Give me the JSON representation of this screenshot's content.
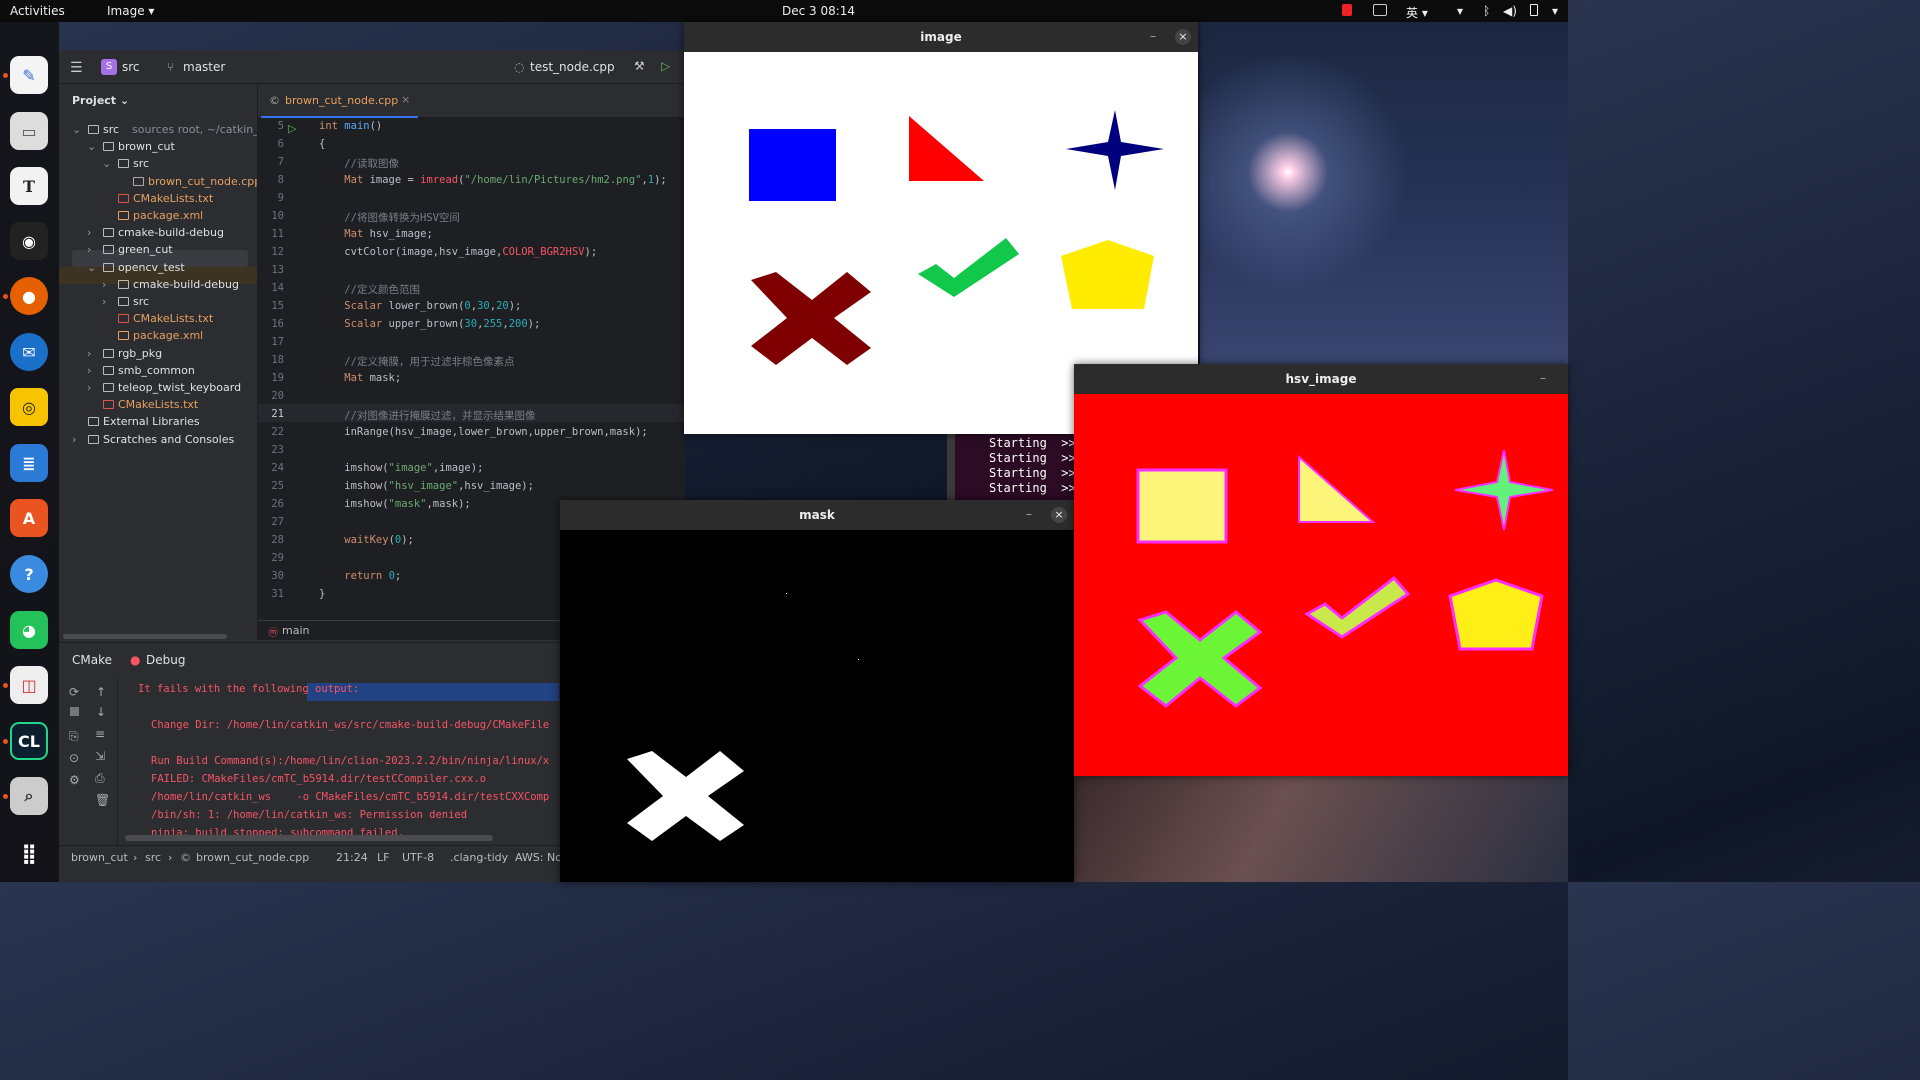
{
  "topbar": {
    "activities": "Activities",
    "app_menu": "Image ▾",
    "clock": "Dec 3  08:14",
    "input_method": "英 ▾"
  },
  "ide": {
    "project_selector": "src",
    "branch": "master",
    "run_config": "test_node.cpp",
    "project_panel_label": "Project ⌄",
    "tree": [
      {
        "label": "src",
        "hint": "sources root, ~/catkin_w",
        "indent": 0,
        "arrow": "⌄",
        "type": "folder"
      },
      {
        "label": "brown_cut",
        "indent": 1,
        "arrow": "⌄",
        "type": "folder"
      },
      {
        "label": "src",
        "indent": 2,
        "arrow": "⌄",
        "type": "folder"
      },
      {
        "label": "brown_cut_node.cpp",
        "indent": 3,
        "arrow": "",
        "type": "cpp"
      },
      {
        "label": "CMakeLists.txt",
        "indent": 2,
        "arrow": "",
        "type": "cmake"
      },
      {
        "label": "package.xml",
        "indent": 2,
        "arrow": "",
        "type": "xml"
      },
      {
        "label": "cmake-build-debug",
        "indent": 1,
        "arrow": "›",
        "type": "folder"
      },
      {
        "label": "green_cut",
        "indent": 1,
        "arrow": "›",
        "type": "folder"
      },
      {
        "label": "opencv_test",
        "indent": 1,
        "arrow": "⌄",
        "type": "folder"
      },
      {
        "label": "cmake-build-debug",
        "indent": 2,
        "arrow": "›",
        "type": "folder"
      },
      {
        "label": "src",
        "indent": 2,
        "arrow": "›",
        "type": "folder"
      },
      {
        "label": "CMakeLists.txt",
        "indent": 2,
        "arrow": "",
        "type": "cmake"
      },
      {
        "label": "package.xml",
        "indent": 2,
        "arrow": "",
        "type": "xml"
      },
      {
        "label": "rgb_pkg",
        "indent": 1,
        "arrow": "›",
        "type": "folder"
      },
      {
        "label": "smb_common",
        "indent": 1,
        "arrow": "›",
        "type": "folder"
      },
      {
        "label": "teleop_twist_keyboard",
        "indent": 1,
        "arrow": "›",
        "type": "folder"
      },
      {
        "label": "CMakeLists.txt",
        "indent": 1,
        "arrow": "",
        "type": "cmake"
      },
      {
        "label": "External Libraries",
        "indent": 0,
        "arrow": "",
        "type": "lib"
      },
      {
        "label": "Scratches and Consoles",
        "indent": 0,
        "arrow": "›",
        "type": "scratch"
      }
    ],
    "editor_tab": "brown_cut_node.cpp",
    "code": [
      {
        "n": "5",
        "html": "<span class='kw'>int</span> <span class='fn'>main</span>()"
      },
      {
        "n": "6",
        "html": "{"
      },
      {
        "n": "7",
        "html": "    <span class='cm'>//读取图像</span>"
      },
      {
        "n": "8",
        "html": "    <span class='ty'>Mat</span> image = <span class='mac'>imread</span>(<span class='str'>\"/home/lin/Pictures/hm2.png\"</span>,<span class='num'>1</span>);"
      },
      {
        "n": "9",
        "html": ""
      },
      {
        "n": "10",
        "html": "    <span class='cm'>//将图像转换为HSV空间</span>"
      },
      {
        "n": "11",
        "html": "    <span class='ty'>Mat</span> hsv_image;"
      },
      {
        "n": "12",
        "html": "    cvtColor(image,hsv_image,<span class='mac'>COLOR_BGR2HSV</span>);"
      },
      {
        "n": "13",
        "html": ""
      },
      {
        "n": "14",
        "html": "    <span class='cm'>//定义颜色范围</span>"
      },
      {
        "n": "15",
        "html": "    <span class='ty'>Scalar</span> lower_brown(<span class='num'>0</span>,<span class='num'>30</span>,<span class='num'>20</span>);"
      },
      {
        "n": "16",
        "html": "    <span class='ty'>Scalar</span> upper_brown(<span class='num'>30</span>,<span class='num'>255</span>,<span class='num'>200</span>);"
      },
      {
        "n": "17",
        "html": ""
      },
      {
        "n": "18",
        "html": "    <span class='cm'>//定义掩膜，用于过滤非棕色像素点</span>"
      },
      {
        "n": "19",
        "html": "    <span class='ty'>Mat</span> mask;"
      },
      {
        "n": "20",
        "html": ""
      },
      {
        "n": "21",
        "html": "    <span class='cm'>//对图像进行掩膜过滤，并显示结果图像</span>"
      },
      {
        "n": "22",
        "html": "    inRange(hsv_image,lower_brown,upper_brown,mask);"
      },
      {
        "n": "23",
        "html": ""
      },
      {
        "n": "24",
        "html": "    imshow(<span class='str'>\"image\"</span>,image);"
      },
      {
        "n": "25",
        "html": "    imshow(<span class='str'>\"hsv_image\"</span>,hsv_image);"
      },
      {
        "n": "26",
        "html": "    imshow(<span class='str'>\"mask\"</span>,mask);"
      },
      {
        "n": "27",
        "html": ""
      },
      {
        "n": "28",
        "html": "    <span class='kw'>waitKey</span>(<span class='num'>0</span>);"
      },
      {
        "n": "29",
        "html": ""
      },
      {
        "n": "30",
        "html": "    <span class='kw'>return</span> <span class='num'>0</span>;"
      },
      {
        "n": "31",
        "html": "}"
      }
    ],
    "breadcrumb_fn": "main",
    "bottom_tabs": {
      "cmake": "CMake",
      "debug": "Debug"
    },
    "console": [
      {
        "text": "It fails with the following output:",
        "indent": false
      },
      {
        "text": "",
        "indent": true
      },
      {
        "text": "Change Dir: /home/lin/catkin_ws/src/cmake-build-debug/CMakeFile",
        "indent": true
      },
      {
        "text": "",
        "indent": true
      },
      {
        "text": "Run Build Command(s):/home/lin/clion-2023.2.2/bin/ninja/linux/x",
        "indent": true
      },
      {
        "text": "FAILED: CMakeFiles/cmTC_b5914.dir/testCCompiler.cxx.o",
        "indent": true
      },
      {
        "text": "/home/lin/catkin_ws    -o CMakeFiles/cmTC_b5914.dir/testCXXComp",
        "indent": true
      },
      {
        "text": "/bin/sh: 1: /home/lin/catkin_ws: Permission denied",
        "indent": true
      },
      {
        "text": "ninja: build stopped: subcommand failed.",
        "indent": true
      }
    ],
    "status": {
      "path1": "brown_cut",
      "path2": "src",
      "path3": "brown_cut_node.cpp",
      "position": "21:24",
      "eol": "LF",
      "encoding": "UTF-8",
      "linter": ".clang-tidy",
      "aws": "AWS: No"
    }
  },
  "terminal": {
    "lines": [
      "Starting  >>",
      "Starting  >>",
      "Starting  >>",
      "Starting  >>"
    ]
  },
  "windows": {
    "image": "image",
    "hsv": "hsv_image",
    "mask": "mask"
  },
  "colors": {
    "blue": "#0000ff",
    "red": "#ff0000",
    "navy": "#00007f",
    "maroon": "#7f0000",
    "green": "#12c84a",
    "yellow": "#ffec00",
    "hsv_bg": "#ff0000",
    "hsv_square": "#fdf57a",
    "hsv_star": "#62f27c",
    "hsv_x": "#6cf536",
    "hsv_check": "#c9e84a",
    "hsv_pent": "#ffef16"
  }
}
